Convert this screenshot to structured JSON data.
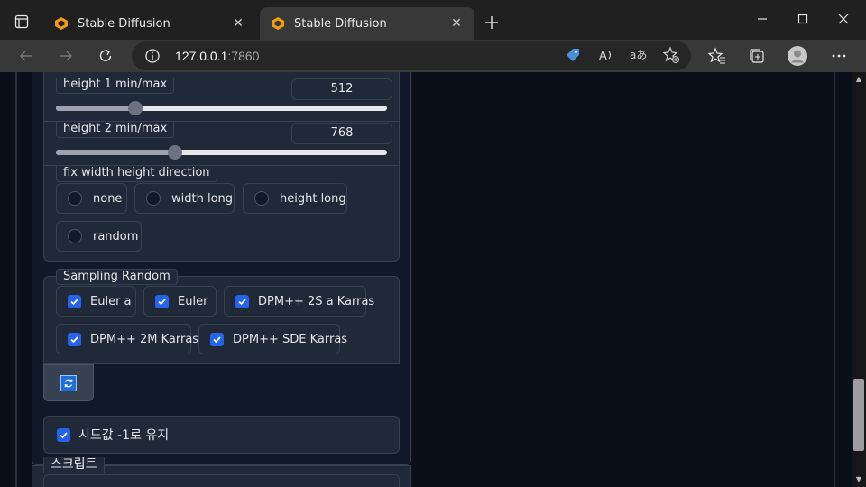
{
  "browser": {
    "tabs": [
      {
        "title": "Stable Diffusion",
        "active": false
      },
      {
        "title": "Stable Diffusion",
        "active": true
      }
    ],
    "url_host": "127.0.0.1",
    "url_port": ":7860"
  },
  "height1": {
    "label": "height 1 min/max",
    "value": "512",
    "fill_fraction": 0.24
  },
  "height2": {
    "label": "height 2 min/max",
    "value": "768",
    "fill_fraction": 0.36
  },
  "direction": {
    "label": "fix width height direction",
    "options": [
      "none",
      "width long",
      "height long",
      "random"
    ],
    "selected": null
  },
  "sampling": {
    "label": "Sampling Random",
    "options": [
      {
        "label": "Euler a",
        "checked": true
      },
      {
        "label": "Euler",
        "checked": true
      },
      {
        "label": "DPM++ 2S a Karras",
        "checked": true
      },
      {
        "label": "DPM++ 2M Karras",
        "checked": true
      },
      {
        "label": "DPM++ SDE Karras",
        "checked": true
      }
    ]
  },
  "seed_keep": {
    "label": "시드값 -1로 유지",
    "checked": true
  },
  "script": {
    "label": "스크립트"
  },
  "colors": {
    "accent": "#2563eb",
    "panel": "#1f2937",
    "background": "#0b0f19"
  }
}
